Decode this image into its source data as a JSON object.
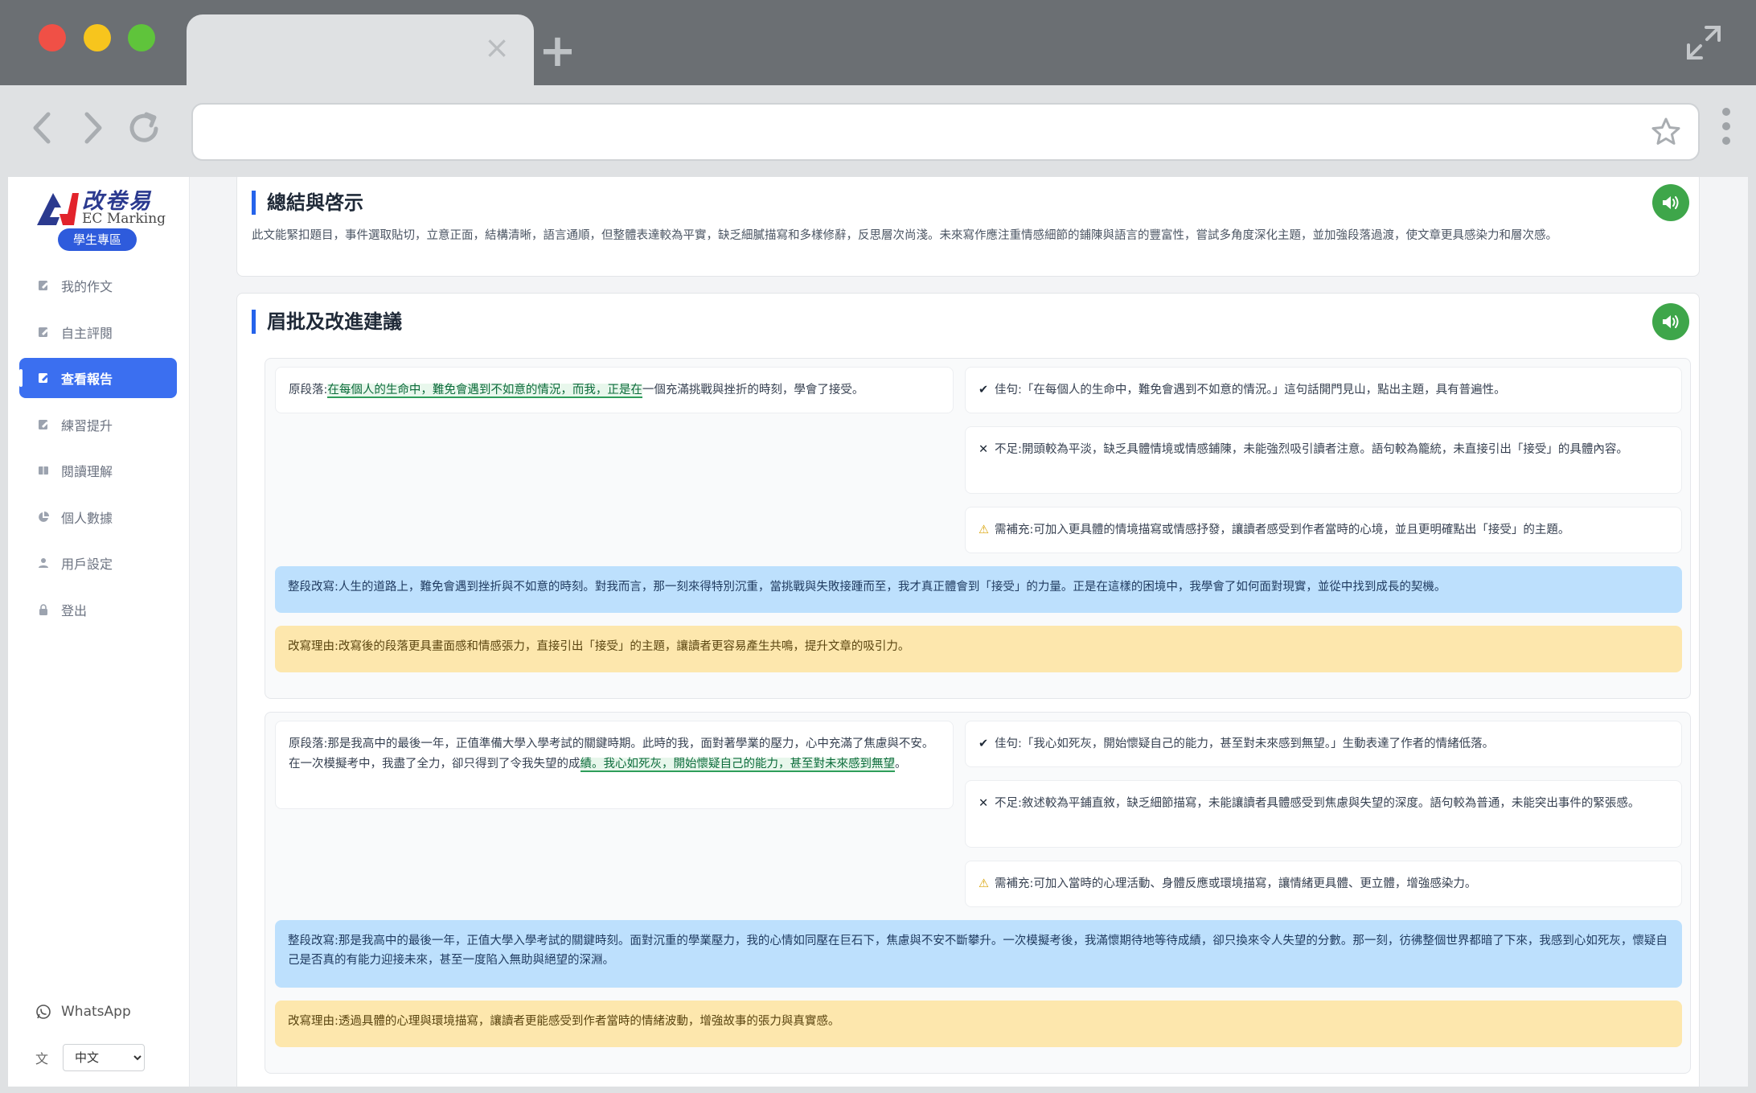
{
  "browser": {
    "tab_close": "×",
    "new_tab": "+"
  },
  "sidebar": {
    "logo": {
      "cn": "改卷易",
      "en": "EC Marking",
      "badge": "學生專區"
    },
    "items": [
      {
        "label": "我的作文",
        "icon": "edit-icon"
      },
      {
        "label": "自主評閱",
        "icon": "edit-icon"
      },
      {
        "label": "查看報告",
        "icon": "edit-icon",
        "active": true
      },
      {
        "label": "練習提升",
        "icon": "edit-icon"
      },
      {
        "label": "閱讀理解",
        "icon": "book-icon"
      },
      {
        "label": "個人數據",
        "icon": "pie-chart-icon"
      },
      {
        "label": "用戶設定",
        "icon": "user-icon"
      },
      {
        "label": "登出",
        "icon": "lock-icon"
      }
    ],
    "whatsapp": "WhatsApp",
    "language": {
      "selected": "中文"
    }
  },
  "summary": {
    "title": "總結與啓示",
    "text": "此文能緊扣題目，事件選取貼切，立意正面，結構清晰，語言通順，但整體表達較為平實，缺乏細膩描寫和多樣修辭，反思層次尚淺。未來寫作應注重情感細節的鋪陳與語言的豐富性，嘗試多角度深化主題，並加強段落過渡，使文章更具感染力和層次感。"
  },
  "comments": {
    "title": "眉批及改進建議",
    "blocks": [
      {
        "orig_prefix": "原段落:",
        "orig_highlight": "在每個人的生命中，難免會遇到不如意的情況，而我，正是在",
        "orig_rest": "一個充滿挑戰與挫折的時刻，學會了接受。",
        "good": "佳句:「在每個人的生命中，難免會遇到不如意的情況。」這句話開門見山，點出主題，具有普遍性。",
        "bad": "不足:開頭較為平淡，缺乏具體情境或情感鋪陳，未能強烈吸引讀者注意。語句較為籠統，未直接引出「接受」的具體內容。",
        "need": "需補充:可加入更具體的情境描寫或情感抒發，讓讀者感受到作者當時的心境，並且更明確點出「接受」的主題。",
        "rewrite": "整段改寫:人生的道路上，難免會遇到挫折與不如意的時刻。對我而言，那一刻來得特別沉重，當挑戰與失敗接踵而至，我才真正體會到「接受」的力量。正是在這樣的困境中，我學會了如何面對現實，並從中找到成長的契機。",
        "reason": "改寫理由:改寫後的段落更具畫面感和情感張力，直接引出「接受」的主題，讓讀者更容易產生共鳴，提升文章的吸引力。"
      },
      {
        "orig_prefix": "原段落:",
        "orig_text": "那是我高中的最後一年，正值準備大學入學考試的關鍵時期。此時的我，面對著學業的壓力，心中充滿了焦慮與不安。在一次模擬考中，我盡了全力，卻只得到了令我失望的成",
        "orig_highlight": "績。我心如死灰，開始懷疑自己的能力，甚至對未來感到無望",
        "orig_rest": "。",
        "good": "佳句:「我心如死灰，開始懷疑自己的能力，甚至對未來感到無望。」生動表達了作者的情緒低落。",
        "bad": "不足:敘述較為平鋪直敘，缺乏細節描寫，未能讓讀者具體感受到焦慮與失望的深度。語句較為普通，未能突出事件的緊張感。",
        "need": "需補充:可加入當時的心理活動、身體反應或環境描寫，讓情緒更具體、更立體，增強感染力。",
        "rewrite": "整段改寫:那是我高中的最後一年，正值大學入學考試的關鍵時刻。面對沉重的學業壓力，我的心情如同壓在巨石下，焦慮與不安不斷攀升。一次模擬考後，我滿懷期待地等待成績，卻只換來令人失望的分數。那一刻，彷彿整個世界都暗了下來，我感到心如死灰，懷疑自己是否真的有能力迎接未來，甚至一度陷入無助與絕望的深淵。",
        "reason": "改寫理由:透過具體的心理與環境描寫，讓讀者更能感受到作者當時的情緒波動，增強故事的張力與真實感。"
      }
    ]
  },
  "colors": {
    "accent": "#3b6ff0",
    "speaker": "#3ea64a",
    "rewrite_bg": "#bde0fd",
    "reason_bg": "#fde7ad"
  }
}
